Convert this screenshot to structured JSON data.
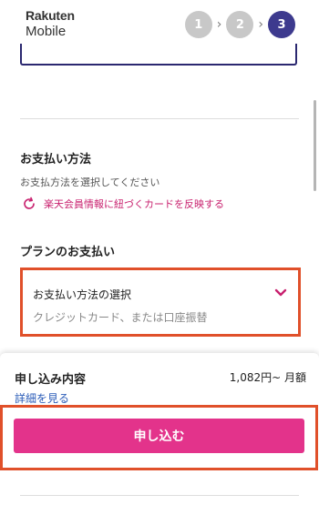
{
  "header": {
    "brand_line1": "Rakuten",
    "brand_line2": "Mobile",
    "steps": [
      {
        "label": "1",
        "state": "done"
      },
      {
        "label": "2",
        "state": "done"
      },
      {
        "label": "3",
        "state": "current"
      }
    ],
    "step_separator": "›"
  },
  "payment_method": {
    "title": "お支払い方法",
    "note": "お支払方法を選択してください",
    "reflect_icon": "refresh-icon",
    "reflect_link": "楽天会員情報に紐づくカードを反映する"
  },
  "plan_payment": {
    "title": "プランのお支払い",
    "select_label": "お支払い方法の選択",
    "select_placeholder": "クレジットカード、または口座振替",
    "chevron_icon": "chevron-down-icon"
  },
  "summary": {
    "title": "申し込み内容",
    "price": "1,082円~ 月額",
    "details_link": "詳細を見る",
    "apply_button": "申し込む"
  },
  "colors": {
    "accent_pink": "#e3338b",
    "link_pink": "#c8206e",
    "step_active": "#3d3a8e",
    "step_done": "#c8c8c8",
    "highlight_red": "#e0502a",
    "link_blue": "#2b5cb8"
  }
}
